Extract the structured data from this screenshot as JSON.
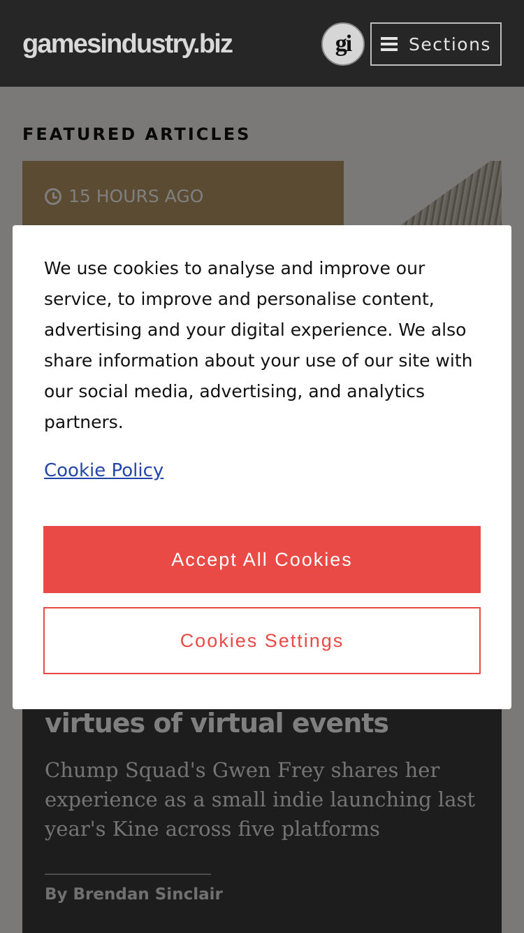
{
  "header": {
    "logo_text": "gamesindustry.biz",
    "badge_text": "gi",
    "sections_label": "Sections"
  },
  "featured": {
    "heading": "FEATURED ARTICLES",
    "article": {
      "time": "15 HOURS AGO",
      "title": "virtues of virtual events",
      "summary": "Chump Squad's Gwen Frey shares her experience as a small indie launching last year's Kine across five platforms",
      "byline": "By Brendan Sinclair"
    }
  },
  "cookie_modal": {
    "text": "We use cookies to analyse and improve our service, to improve and personalise content, advertising and your digital experience. We also share information about your use of our site with our social media, advertising, and analytics partners.",
    "policy_link": "Cookie Policy",
    "accept_label": "Accept All Cookies",
    "settings_label": "Cookies Settings"
  },
  "colors": {
    "header_bg": "#262626",
    "accent_red": "#e94a45",
    "link_blue": "#2446a8"
  },
  "icons": {
    "menu": "hamburger-icon",
    "time": "clock-icon"
  }
}
